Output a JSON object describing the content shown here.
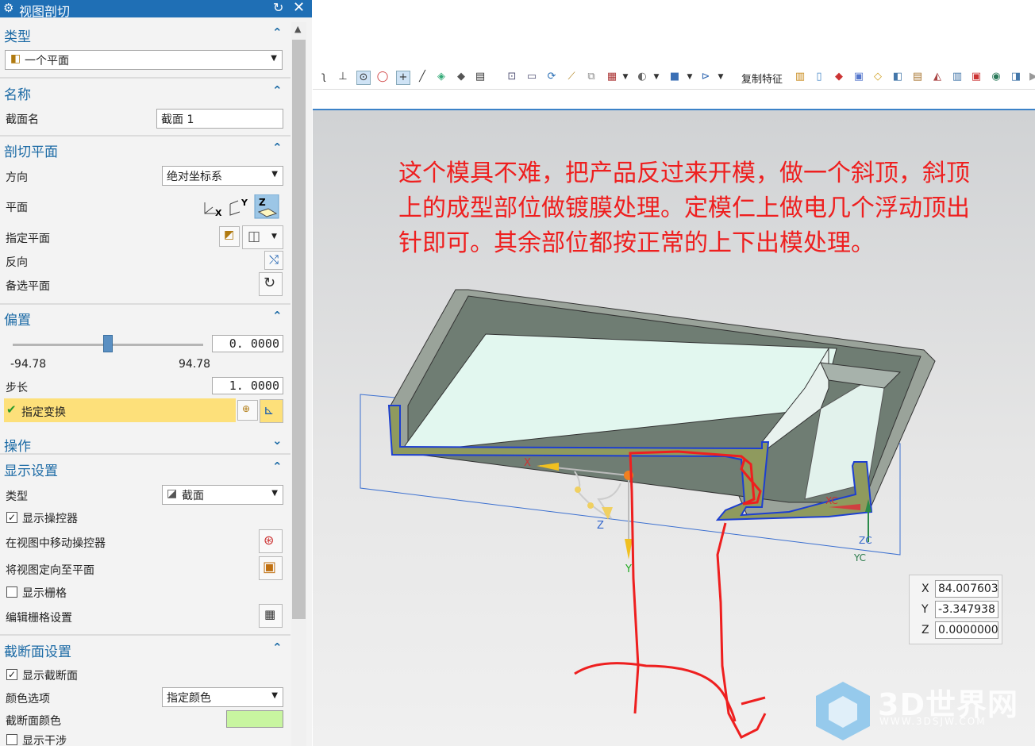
{
  "dialog": {
    "title": "视图剖切",
    "sections": {
      "type": {
        "label": "类型",
        "value": "一个平面"
      },
      "name": {
        "label": "名称",
        "field_label": "截面名",
        "field_value": "截面 1"
      },
      "cut_plane": {
        "label": "剖切平面",
        "direction_label": "方向",
        "direction_value": "绝对坐标系",
        "plane_label": "平面",
        "specify_plane_label": "指定平面",
        "reverse_label": "反向",
        "alt_plane_label": "备选平面"
      },
      "offset": {
        "label": "偏置",
        "value": "0. 0000",
        "min": "-94.78",
        "max": "94.78",
        "slider_fraction": 0.5,
        "step_label": "步长",
        "step_value": "1. 0000",
        "transform_label": "指定变换"
      },
      "operation": {
        "label": "操作"
      },
      "display": {
        "label": "显示设置",
        "type_label": "类型",
        "type_value": "截面",
        "show_manip_label": "显示操控器",
        "show_manip_checked": true,
        "move_manip_label": "在视图中移动操控器",
        "orient_label": "将视图定向至平面",
        "show_grid_label": "显示栅格",
        "show_grid_checked": false,
        "edit_grid_label": "编辑栅格设置"
      },
      "section_settings": {
        "label": "截断面设置",
        "show_section_label": "显示截断面",
        "show_section_checked": true,
        "color_option_label": "颜色选项",
        "color_option_value": "指定颜色",
        "section_color_label": "截断面颜色",
        "section_color": "#c8f5a0",
        "partial_label": "显示干涉"
      }
    }
  },
  "toolbar": {
    "copy_feature_label": "复制特征"
  },
  "viewport": {
    "note_lines": [
      "这个模具不难，把产品反过来开模，做一个斜顶，斜顶",
      "上的成型部位做镀膜处理。定模仁上做电几个浮动顶出",
      "针即可。其余部位都按正常的上下出模处理。"
    ],
    "manipulator": {
      "x": "X",
      "y": "Y",
      "z": "Z"
    },
    "wcs": {
      "xc": "XC",
      "yc": "YC",
      "zc": "ZC"
    },
    "coords": [
      {
        "axis": "X",
        "value": "84.007603"
      },
      {
        "axis": "Y",
        "value": "-3.347938"
      },
      {
        "axis": "Z",
        "value": "0.0000000"
      }
    ],
    "watermark": {
      "brand": "3D世界网",
      "url": "WWW.3DSJW.COM"
    }
  },
  "colors": {
    "title_bar": "#1f6fb5",
    "section_label": "#1b6aa5",
    "highlight_row": "#fde07a",
    "annotation": "#ee1f1f"
  }
}
